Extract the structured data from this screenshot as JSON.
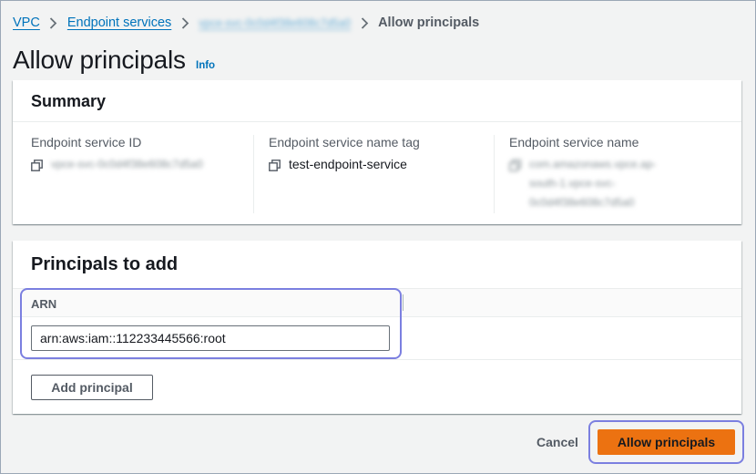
{
  "breadcrumb": {
    "items": [
      {
        "label": "VPC"
      },
      {
        "label": "Endpoint services"
      },
      {
        "label": "vpce-svc-0c0d4f38e608c7d5a0"
      }
    ],
    "current": "Allow principals"
  },
  "page": {
    "title": "Allow principals",
    "info_label": "Info"
  },
  "summary": {
    "title": "Summary",
    "fields": [
      {
        "label": "Endpoint service ID",
        "value": "vpce-svc-0c0d4f38e608c7d5a0"
      },
      {
        "label": "Endpoint service name tag",
        "value": "test-endpoint-service"
      },
      {
        "label": "Endpoint service name",
        "value_lines": [
          "com.amazonaws.vpce.ap-",
          "south-1.vpce-svc-",
          "0c0d4f38e608c7d5a0"
        ]
      }
    ]
  },
  "principals": {
    "title": "Principals to add",
    "column_header": "ARN",
    "arn_value": "arn:aws:iam::112233445566:root",
    "add_button_label": "Add principal"
  },
  "footer": {
    "cancel_label": "Cancel",
    "submit_label": "Allow principals"
  },
  "colors": {
    "link": "#0073bb",
    "primary_button": "#ec7211",
    "highlight": "#7b7fe0",
    "background": "#f2f3f3"
  },
  "icons": {
    "copy": "copy-icon",
    "separator": "chevron-right-icon"
  }
}
